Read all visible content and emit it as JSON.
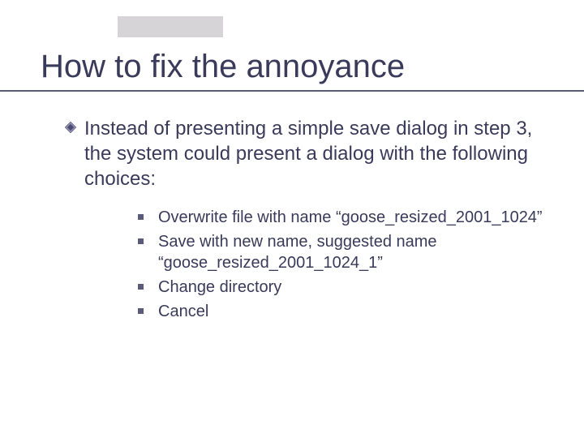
{
  "slide": {
    "title": "How to fix the annoyance",
    "main_bullet": "Instead of presenting a simple save dialog in step 3, the system could present a dialog with the following choices:",
    "sub_items": [
      "Overwrite file with name “goose_resized_2001_1024”",
      "Save with new name, suggested name “goose_resized_2001_1024_1”",
      "Change directory",
      "Cancel"
    ]
  }
}
